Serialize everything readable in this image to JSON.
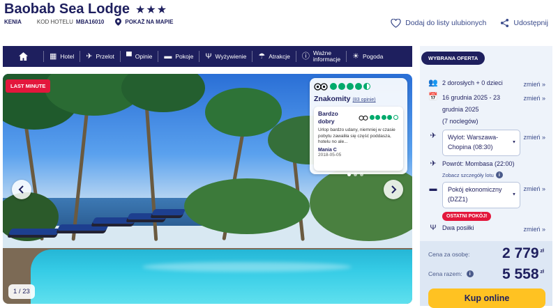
{
  "hotel": {
    "name": "Baobab Sea Lodge",
    "stars": "★★★",
    "country": "KENIA",
    "code_label": "KOD HOTELU",
    "code_value": "MBA16010",
    "map_link": "POKAŻ NA MAPIE"
  },
  "actions": {
    "favorites": "Dodaj do listy ulubionych",
    "share": "Udostępnij"
  },
  "nav": {
    "items": [
      {
        "label": "Hotel",
        "icon": "hotel-icon"
      },
      {
        "label": "Przelot",
        "icon": "plane-icon"
      },
      {
        "label": "Opinie",
        "icon": "chat-icon"
      },
      {
        "label": "Pokoje",
        "icon": "bed-icon"
      },
      {
        "label": "Wyżywienie",
        "icon": "cutlery-icon"
      },
      {
        "label": "Atrakcje",
        "icon": "umbrella-icon"
      },
      {
        "label_line1": "Ważne",
        "label_line2": "informacje",
        "icon": "info-icon"
      },
      {
        "label": "Pogoda",
        "icon": "sun-icon"
      }
    ]
  },
  "gallery": {
    "badge": "LAST MINUTE",
    "counter": "1 / 23"
  },
  "review": {
    "rating_word": "Znakomity",
    "rating_count": "(83 opinie)",
    "bubbles_filled": 4.5,
    "title": "Bardzo dobry",
    "text": "Urlop bardzo udany, niemniej w czasie pobytu zawaliła się część poddasza, hotelu no ale...",
    "author": "Mania C",
    "date": "2018-05-05",
    "item_bubbles_filled": 4
  },
  "offer": {
    "badge": "WYBRANA OFERTA",
    "guests": "2 dorosłych + 0 dzieci",
    "dates_line1": "16 grudnia 2025 - 23",
    "dates_line2": "grudnia 2025",
    "nights": "(7 noclegów)",
    "departure_line1": "Wylot: Warszawa-",
    "departure_line2": "Chopina (08:30)",
    "return": "Powrót: Mombasa (22:00)",
    "flight_details": "Zobacz szczegóły lotu",
    "room_line1": "Pokój ekonomiczny",
    "room_line2": "(DZZ1)",
    "last_rooms": "OSTATNI POKÓJ!",
    "board": "Dwa posiłki",
    "change_label": "zmień »"
  },
  "price": {
    "per_person_label": "Cena za osobę:",
    "per_person_value": "2 779",
    "total_label": "Cena razem:",
    "total_value": "5 558",
    "currency": "zł",
    "buy_button": "Kup online"
  },
  "colors": {
    "navy": "#1e1f5e",
    "accent_red": "#e3173c",
    "buy_yellow": "#ffc222",
    "tripadvisor_green": "#00aa6c"
  }
}
